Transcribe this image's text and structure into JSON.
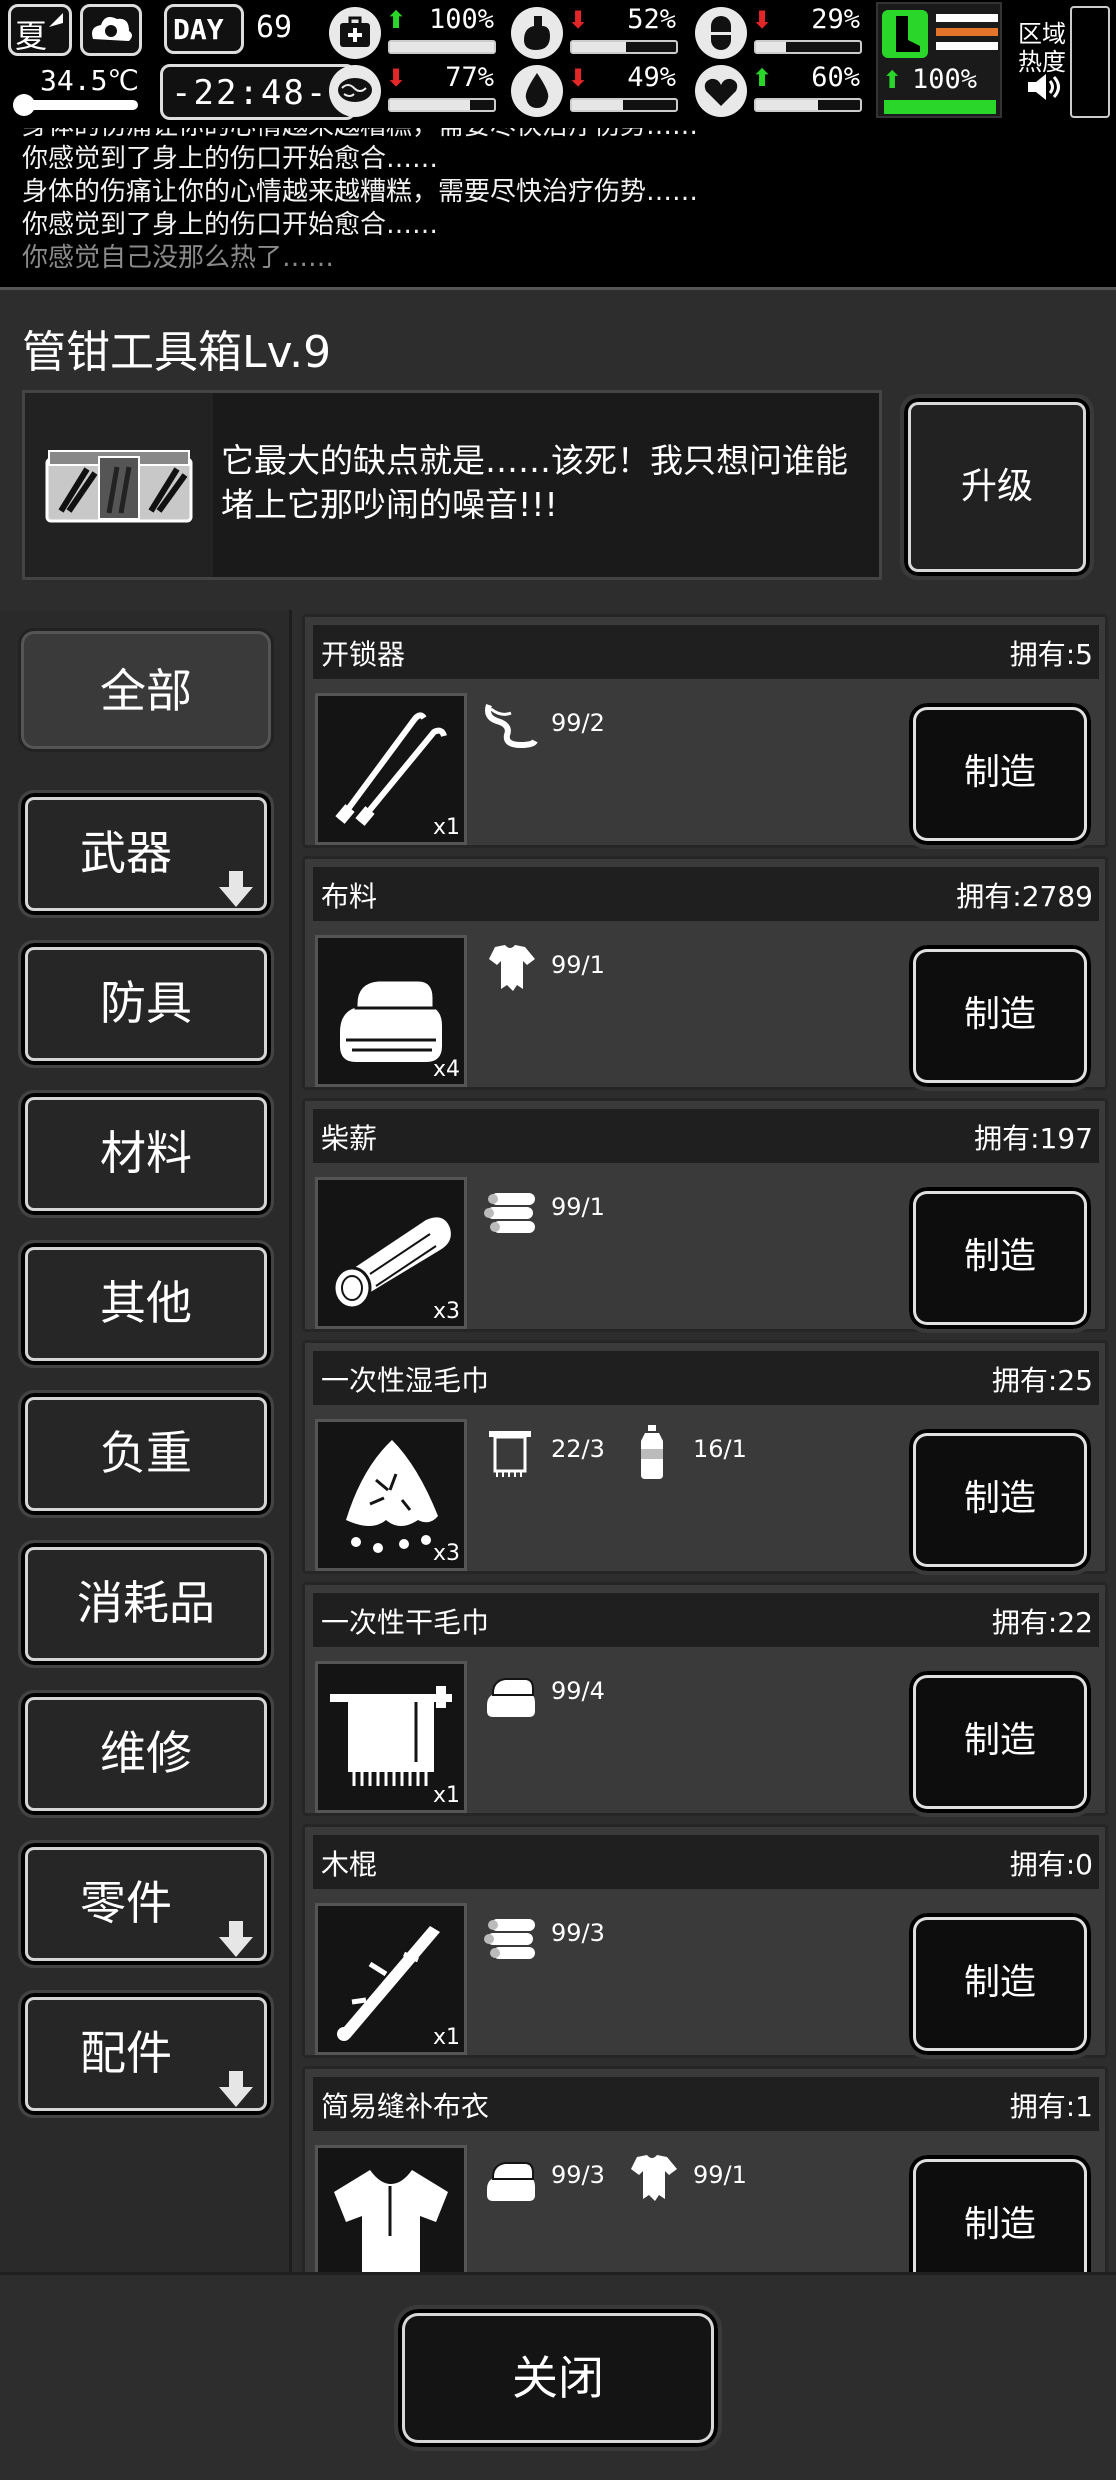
{
  "status": {
    "season": "夏",
    "day_label": "DAY",
    "day": "69",
    "temperature": "34.5℃",
    "time": "-22:48-",
    "zone_heat_line1": "区域",
    "zone_heat_line2": "热度",
    "stats": [
      {
        "name": "health",
        "icon": "medkit-icon",
        "trend": "up",
        "value": "100%",
        "level": 1.0
      },
      {
        "name": "hunger",
        "icon": "stomach-icon",
        "trend": "down",
        "value": "52%",
        "level": 0.52
      },
      {
        "name": "medicine",
        "icon": "pill-icon",
        "trend": "down",
        "value": "29%",
        "level": 0.29
      },
      {
        "name": "mood",
        "icon": "brain-icon",
        "trend": "down",
        "value": "77%",
        "level": 0.77
      },
      {
        "name": "thirst",
        "icon": "water-drop-icon",
        "trend": "down",
        "value": "49%",
        "level": 0.49
      },
      {
        "name": "heart",
        "icon": "heart-icon",
        "trend": "up",
        "value": "60%",
        "level": 0.6
      },
      {
        "name": "stamina",
        "icon": "leg-icon",
        "trend": "up",
        "value": "100%",
        "level": 1.0
      }
    ]
  },
  "log": {
    "partial_line": "身体的伤痛让你的心情越来越糟糕，需要尽快治疗伤势……",
    "lines": [
      "你感觉到了身上的伤口开始愈合……",
      "身体的伤痛让你的心情越来越糟糕，需要尽快治疗伤势……",
      "你感觉到了身上的伤口开始愈合……"
    ],
    "fading_line": "你感觉自己没那么热了……"
  },
  "tool": {
    "title": "管钳工具箱Lv.9",
    "description": "它最大的缺点就是……该死！我只想问谁能堵上它那吵闹的噪音!!!",
    "upgrade_label": "升级"
  },
  "categories": [
    {
      "label": "全部",
      "active": true,
      "has_sub": false
    },
    {
      "label": "武器",
      "active": false,
      "has_sub": true
    },
    {
      "label": "防具",
      "active": false,
      "has_sub": false
    },
    {
      "label": "材料",
      "active": false,
      "has_sub": false
    },
    {
      "label": "其他",
      "active": false,
      "has_sub": false
    },
    {
      "label": "负重",
      "active": false,
      "has_sub": false
    },
    {
      "label": "消耗品",
      "active": false,
      "has_sub": false
    },
    {
      "label": "维修",
      "active": false,
      "has_sub": false
    },
    {
      "label": "零件",
      "active": false,
      "has_sub": true
    },
    {
      "label": "配件",
      "active": false,
      "has_sub": true
    }
  ],
  "craft_label": "制造",
  "items": [
    {
      "name": "开锁器",
      "owned": "拥有:5",
      "qty": "x1",
      "icon": "lockpick-icon",
      "materials": [
        {
          "icon": "wire-icon",
          "value": "99/2"
        }
      ]
    },
    {
      "name": "布料",
      "owned": "拥有:2789",
      "qty": "x4",
      "icon": "folded-cloth-icon",
      "materials": [
        {
          "icon": "torn-shirt-icon",
          "value": "99/1"
        }
      ]
    },
    {
      "name": "柴薪",
      "owned": "拥有:197",
      "qty": "x3",
      "icon": "firewood-icon",
      "materials": [
        {
          "icon": "logs-icon",
          "value": "99/1"
        }
      ]
    },
    {
      "name": "一次性湿毛巾",
      "owned": "拥有:25",
      "qty": "x3",
      "icon": "wet-towel-icon",
      "materials": [
        {
          "icon": "towel-icon",
          "value": "22/3"
        },
        {
          "icon": "water-bottle-icon",
          "value": "16/1"
        }
      ]
    },
    {
      "name": "一次性干毛巾",
      "owned": "拥有:22",
      "qty": "x1",
      "icon": "hanging-towel-icon",
      "materials": [
        {
          "icon": "cloth-stack-icon",
          "value": "99/4"
        }
      ]
    },
    {
      "name": "木棍",
      "owned": "拥有:0",
      "qty": "x1",
      "icon": "wooden-stick-icon",
      "materials": [
        {
          "icon": "logs-icon",
          "value": "99/3"
        }
      ]
    },
    {
      "name": "简易缝补布衣",
      "owned": "拥有:1",
      "qty": "",
      "icon": "patched-shirt-icon",
      "materials": [
        {
          "icon": "cloth-stack-icon",
          "value": "99/3"
        },
        {
          "icon": "torn-shirt-icon",
          "value": "99/1"
        }
      ]
    }
  ],
  "close_label": "关闭"
}
